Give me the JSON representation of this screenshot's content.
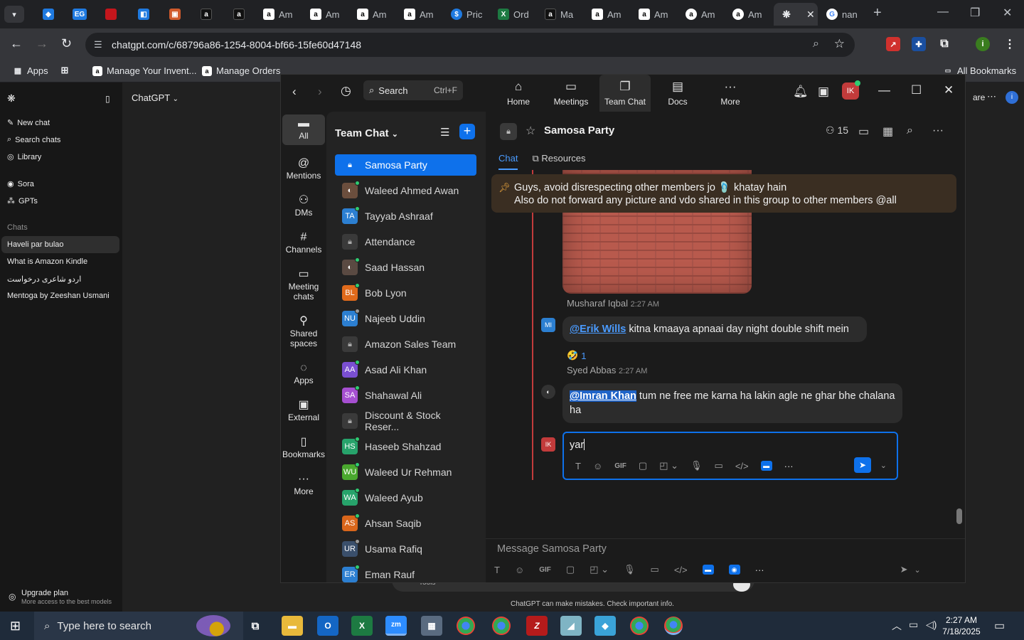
{
  "browser": {
    "tabs": [
      {
        "label": "",
        "icon": "dropdown-icon"
      },
      {
        "label": "",
        "color": "#1f7ae0"
      },
      {
        "label": "EG",
        "color": "#1f7ae0"
      },
      {
        "label": "",
        "color": "#c4161c"
      },
      {
        "label": "",
        "color": "#1f7ae0"
      },
      {
        "label": "",
        "color": "#d05a2c"
      },
      {
        "label": "a",
        "color": "#000000"
      },
      {
        "label": "a",
        "color": "#000000"
      },
      {
        "label": "Am",
        "color": "#ffffff"
      },
      {
        "label": "Am",
        "color": "#ffffff"
      },
      {
        "label": "Am",
        "color": "#ffffff"
      },
      {
        "label": "Am",
        "color": "#ffffff"
      },
      {
        "label": "Pric",
        "color": "#1f7ae0"
      },
      {
        "label": "Ord",
        "color": "#1d7a42"
      },
      {
        "label": "Ma",
        "color": "#000000"
      },
      {
        "label": "Am",
        "color": "#ffffff"
      },
      {
        "label": "Am",
        "color": "#ffffff"
      },
      {
        "label": "Am",
        "color": "#ffffff"
      },
      {
        "label": "Am",
        "color": "#ffffff"
      },
      {
        "label": "",
        "color": "#e8eaed"
      },
      {
        "label": "nan",
        "color": "#4285f4"
      }
    ],
    "url": "chatgpt.com/c/68796a86-1254-8004-bf66-15fe60d47148",
    "bookmarks": {
      "apps": "Apps",
      "items": [
        "Manage Your Invent...",
        "Manage Orders"
      ],
      "all_bookmarks": "All Bookmarks"
    },
    "profile_initial": "i"
  },
  "chatgpt": {
    "title": "ChatGPT",
    "new_chat": "New chat",
    "search_chats": "Search chats",
    "library": "Library",
    "sora": "Sora",
    "gpts": "GPTs",
    "chats_label": "Chats",
    "chats": [
      "Haveli par bulao",
      "What is Amazon Kindle",
      "اردو شاعری درخواست",
      "Mentoga by Zeeshan Usmani"
    ],
    "upgrade_title": "Upgrade plan",
    "upgrade_sub": "More access to the best models",
    "disclaimer": "ChatGPT can make mistakes. Check important info.",
    "share_fragment": "are",
    "tools_fragment": "Tools"
  },
  "zoom": {
    "search_label": "Search",
    "search_hint": "Ctrl+F",
    "topnav": [
      "Home",
      "Meetings",
      "Team Chat",
      "Docs",
      "More"
    ],
    "user_initials": "IK",
    "rail": [
      "All",
      "Mentions",
      "DMs",
      "Channels",
      "Meeting chats",
      "Shared spaces",
      "Apps",
      "External",
      "Bookmarks",
      "More"
    ],
    "list_title": "Team Chat",
    "channels": [
      {
        "name": "Samosa Party",
        "type": "lock",
        "selected": true
      },
      {
        "name": "Waleed Ahmed Awan",
        "type": "photo",
        "color": "#6b4e3d",
        "status": "#2ecc71"
      },
      {
        "name": "Tayyab Ashraaf",
        "initials": "TA",
        "color": "#2c7fd1",
        "status": "#2ecc71"
      },
      {
        "name": "Attendance",
        "type": "lock"
      },
      {
        "name": "Saad Hassan",
        "type": "photo",
        "color": "#5a4a42",
        "status": "#2ecc71"
      },
      {
        "name": "Bob Lyon",
        "initials": "BL",
        "color": "#e06a1b",
        "status": "#2ecc71"
      },
      {
        "name": "Najeeb Uddin",
        "initials": "NU",
        "color": "#2c7fd1",
        "status": "#9a9a9a"
      },
      {
        "name": "Amazon Sales Team",
        "type": "lock"
      },
      {
        "name": "Asad Ali Khan",
        "initials": "AA",
        "color": "#7a4fd1",
        "status": "#2ecc71"
      },
      {
        "name": "Shahawal Ali",
        "initials": "SA",
        "color": "#a64fd1",
        "status": "#2ecc71"
      },
      {
        "name": "Discount & Stock Reser...",
        "type": "lock"
      },
      {
        "name": "Haseeb Shahzad",
        "initials": "HS",
        "color": "#27a36b",
        "status": "#2ecc71"
      },
      {
        "name": "Waleed Ur Rehman",
        "initials": "WU",
        "color": "#4aa82e",
        "status": "#2ecc71"
      },
      {
        "name": "Waleed Ayub",
        "initials": "WA",
        "color": "#27a36b",
        "status": "#2ecc71"
      },
      {
        "name": "Ahsan Saqib",
        "initials": "AS",
        "color": "#d9661b",
        "status": "#2ecc71"
      },
      {
        "name": "Usama Rafiq",
        "initials": "UR",
        "color": "#3a4f6b",
        "status": "#9a9a9a"
      },
      {
        "name": "Eman Rauf",
        "initials": "ER",
        "color": "#2c7fd1",
        "status": "#2ecc71"
      }
    ],
    "conversation": {
      "title": "Samosa Party",
      "member_count": "15",
      "tabs": [
        "Chat",
        "Resources"
      ],
      "pinned_line1": "Guys, avoid disrespecting other members jo 🩴 khatay hain",
      "pinned_line2": "Also do not forward any picture and vdo shared in this group to other members @all",
      "messages": [
        {
          "sender": "Musharaf Iqbal",
          "time": "2:27 AM",
          "initials": "MI",
          "mention": "@Erik Wills",
          "text": " kitna kmaaya apnaai day night double shift mein",
          "reaction": "🤣",
          "reaction_count": "1"
        },
        {
          "sender": "Syed Abbas",
          "time": "2:27 AM",
          "mention": "@Imran Khan",
          "text": " tum ne free me karna ha lakin agle ne ghar bhe chalana ha"
        }
      ],
      "reply_value": "yar",
      "compose_placeholder": "Message Samosa Party"
    }
  },
  "taskbar": {
    "search_placeholder": "Type here to search",
    "time": "2:27 AM",
    "date": "7/18/2025"
  }
}
